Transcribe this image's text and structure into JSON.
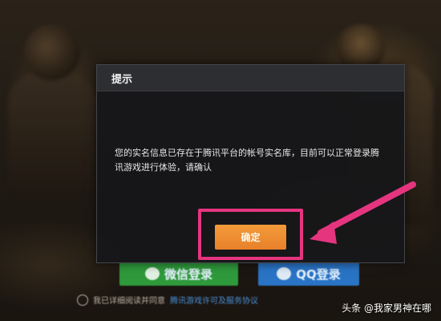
{
  "dialog": {
    "title": "提示",
    "message": "您的实名信息已存在于腾讯平台的帐号实名库，目前可以正常登录腾讯游戏进行体验，请确认",
    "confirm_label": "确定"
  },
  "login": {
    "wechat_label": "微信登录",
    "qq_label": "QQ登录",
    "agreement_text": "我已详细阅读并同意",
    "agreement_link": "腾讯游戏许可及服务协议"
  },
  "watermark": "头条 @我家男神在哪",
  "colors": {
    "confirm_button": "#f08f33",
    "highlight": "#e5357f",
    "wechat": "#2f9a3c",
    "qq": "#2a74c6"
  },
  "icons": {
    "wechat": "wechat-icon",
    "qq": "qq-icon",
    "arrow": "pointer-arrow"
  }
}
